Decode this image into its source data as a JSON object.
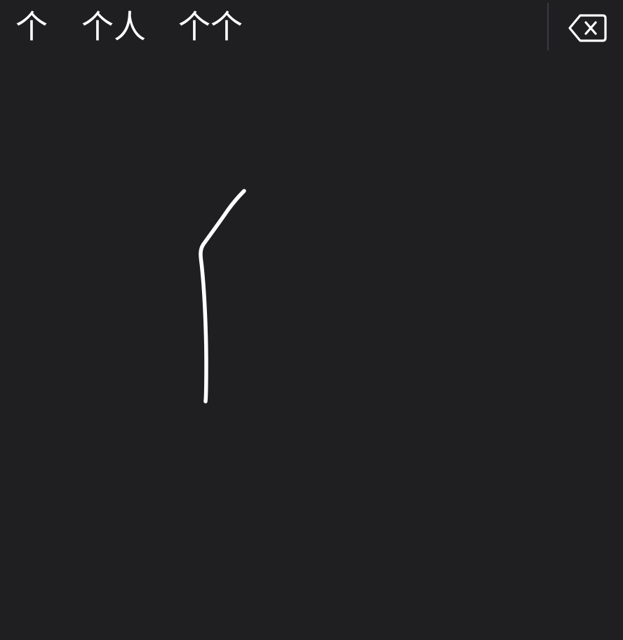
{
  "candidates": {
    "items": [
      {
        "text": "个"
      },
      {
        "text": "个人"
      },
      {
        "text": "个个"
      }
    ]
  },
  "delete_key": {
    "icon": "backspace-delete-icon"
  },
  "handwriting": {
    "stroke_color": "#ffffff",
    "background_color": "#1f1e21"
  }
}
